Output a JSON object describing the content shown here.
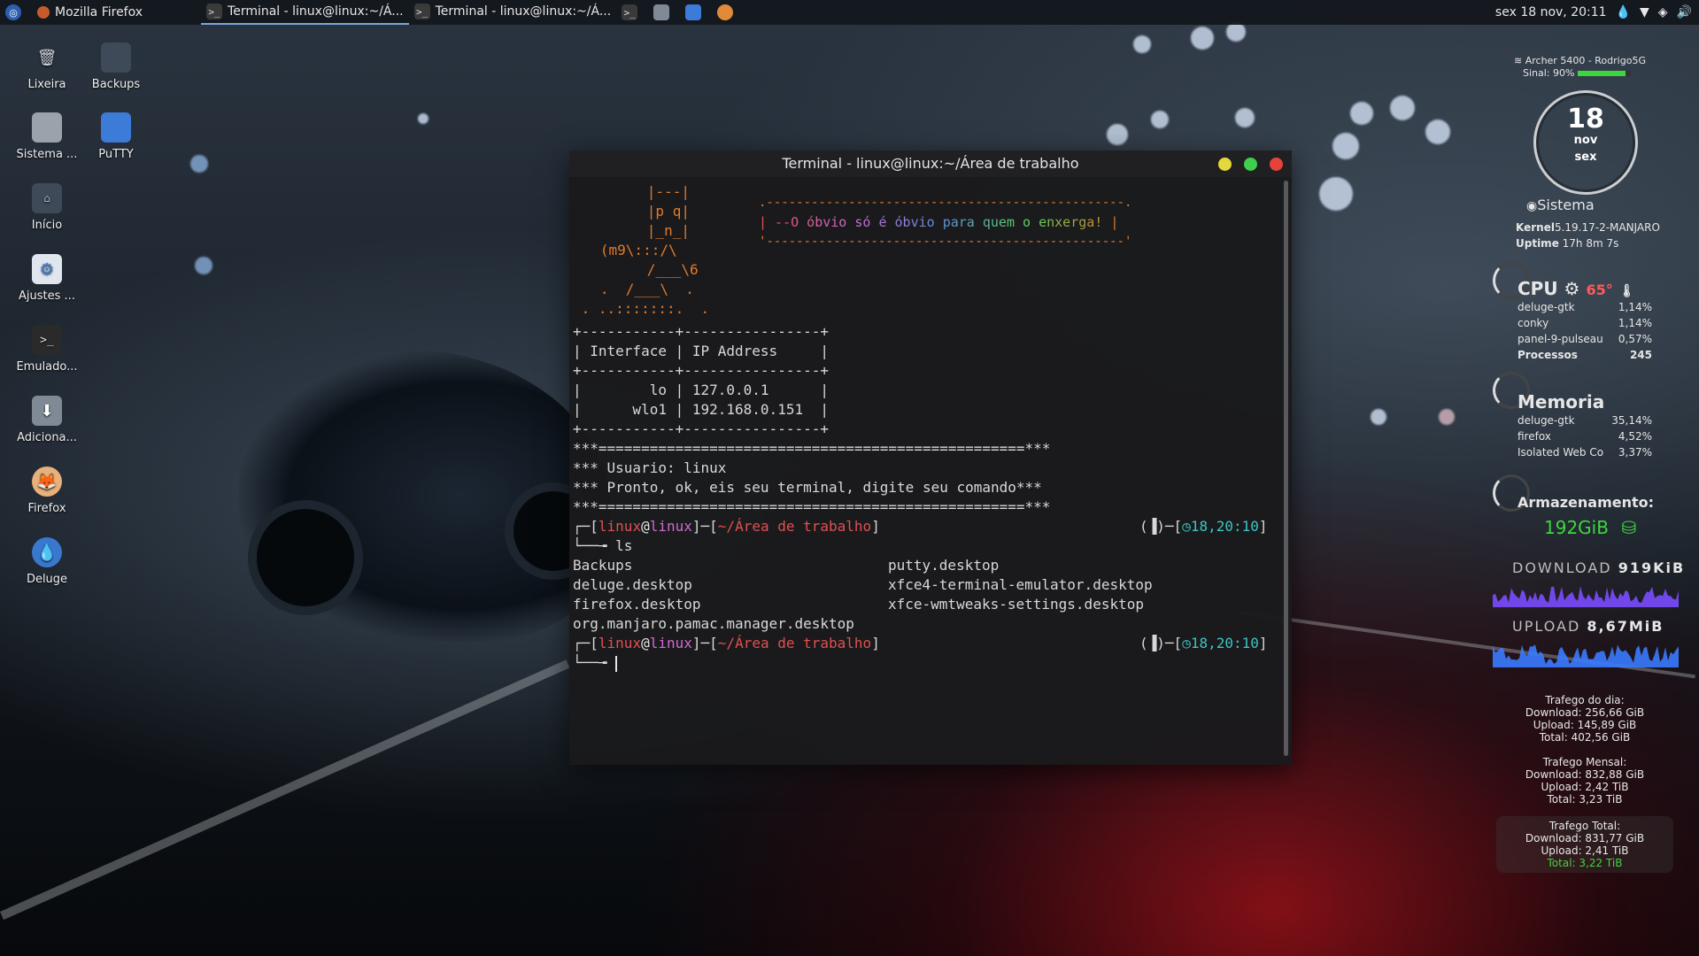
{
  "panel": {
    "app_name": "Mozilla Firefox",
    "tasks": [
      {
        "label": "Terminal - linux@linux:~/Á...",
        "active": true
      },
      {
        "label": "Terminal - linux@linux:~/Á...",
        "active": false
      }
    ],
    "clock": "sex 18 nov, 20:11"
  },
  "desktop": {
    "icons": [
      {
        "label": "Lixeira",
        "icon": "trash-icon"
      },
      {
        "label": "Backups",
        "icon": "folder-icon"
      },
      {
        "label": "Sistema ...",
        "icon": "system-icon"
      },
      {
        "label": "PuTTY",
        "icon": "putty-icon"
      },
      {
        "label": "Início",
        "icon": "home-folder-icon"
      },
      {
        "label": "Ajustes ...",
        "icon": "settings-icon"
      },
      {
        "label": "Emulado...",
        "icon": "terminal-icon"
      },
      {
        "label": "Adiciona...",
        "icon": "download-icon"
      },
      {
        "label": "Firefox",
        "icon": "firefox-icon"
      },
      {
        "label": "Deluge",
        "icon": "deluge-icon"
      }
    ]
  },
  "terminal": {
    "title": "Terminal - linux@linux:~/Área de trabalho",
    "ascii_art": [
      "      |---|",
      "      |p q|",
      "      |_n_|",
      "   (m9\\:::/\\",
      "      /___\\6",
      "   .  /___\\  .",
      " . ..:::::::.  ."
    ],
    "quote_border_top": ".------------------------------------------------.",
    "quote": "| --O óbvio só é óbvio para quem o enxerga! |",
    "quote_border_bottom": "'------------------------------------------------'",
    "table": {
      "border": "+-----------+----------------+",
      "header": "| Interface | IP Address     |",
      "rows": [
        "|        lo | 127.0.0.1      |",
        "|      wlo1 | 192.168.0.151  |"
      ]
    },
    "banner_line": "***==================================================***",
    "user_line": "*** Usuario: linux",
    "ready_line": "*** Pronto, ok, eis seu terminal, digite seu comando***",
    "prompt": {
      "user": "linux",
      "at": "@",
      "host": "linux",
      "path": "~/Área de trabalho",
      "time": "18,20:10"
    },
    "command": "ls",
    "ls_output": [
      [
        "Backups",
        "putty.desktop"
      ],
      [
        "deluge.desktop",
        "xfce4-terminal-emulator.desktop"
      ],
      [
        "firefox.desktop",
        "xfce-wmtweaks-settings.desktop"
      ],
      [
        "org.manjaro.pamac.manager.desktop",
        ""
      ]
    ]
  },
  "conky": {
    "wifi_name": "Archer 5400 - Rodrigo5G",
    "signal_label": "Sinal:",
    "signal_value": "90%",
    "signal_fraction": 0.9,
    "date_day": "18",
    "date_month": "nov",
    "date_weekday": "sex",
    "sistema_title": "Sistema",
    "kernel_label": "Kernel",
    "kernel_value": "5.19.17-2-MANJARO",
    "uptime_label": "Uptime",
    "uptime_value": "17h 8m 7s",
    "cpu_title": "CPU",
    "cpu_temp": "65°",
    "cpu_processes": [
      {
        "name": "deluge-gtk",
        "value": "1,14%"
      },
      {
        "name": "conky",
        "value": "1,14%"
      },
      {
        "name": "panel-9-pulseau",
        "value": "0,57%"
      }
    ],
    "processes_label": "Processos",
    "processes_value": "245",
    "mem_title": "Memoria",
    "mem_processes": [
      {
        "name": "deluge-gtk",
        "value": "35,14%"
      },
      {
        "name": "firefox",
        "value": "4,52%"
      },
      {
        "name": "Isolated Web Co",
        "value": "3,37%"
      }
    ],
    "storage_title": "Armazenamento:",
    "storage_value": "192GiB",
    "download_label": "DOWNLOAD",
    "download_value": "919KiB",
    "upload_label": "UPLOAD",
    "upload_value": "8,67MiB",
    "traffic_day": {
      "title": "Trafego do dia:",
      "download": "Download: 256,66 GiB",
      "upload": "Upload: 145,89 GiB",
      "total": "Total: 402,56 GiB"
    },
    "traffic_month": {
      "title": "Trafego Mensal:",
      "download": "Download: 832,88 GiB",
      "upload": "Upload: 2,42 TiB",
      "total": "Total: 3,23 TiB"
    },
    "traffic_total": {
      "title": "Trafego Total:",
      "download": "Download: 831,77 GiB",
      "upload": "Upload: 2,41 TiB",
      "total": "Total: 3,22 TiB"
    }
  },
  "colors": {
    "prompt_user": "#e05050",
    "prompt_host": "#d06ad0",
    "prompt_path": "#e05050",
    "time": "#3fc4c4",
    "accent_green": "#3ed63e",
    "download_graph": "#7a4dff",
    "upload_graph": "#3a7bff"
  }
}
